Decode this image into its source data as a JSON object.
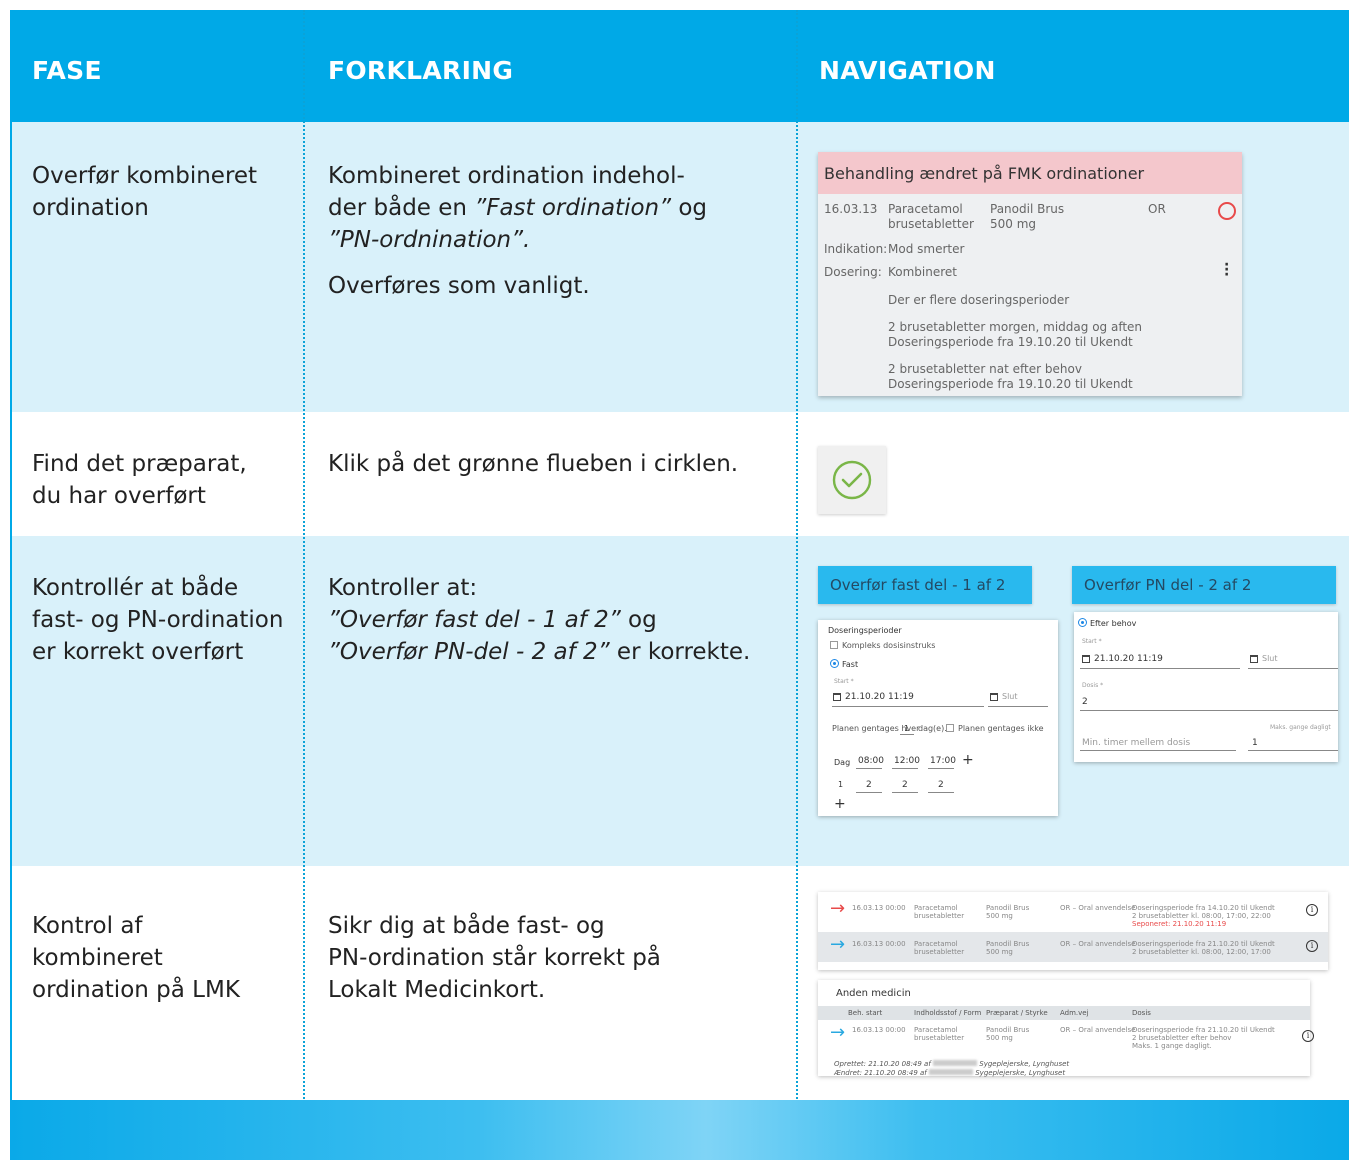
{
  "header": {
    "col1": "FASE",
    "col2": "FORKLARING",
    "col3": "NAVIGATION"
  },
  "rows": [
    {
      "fase": [
        "Overfør kombineret",
        "ordination"
      ],
      "forklaring_1": "Kombineret ordination indehol-",
      "forklaring_2a": "der både en ",
      "forklaring_2b": "”Fast ordination”",
      "forklaring_2c": " og",
      "forklaring_3": "”PN-ordnination”.",
      "forklaring_4": "Overføres som vanligt."
    },
    {
      "fase": [
        "Find det præparat,",
        "du har overført"
      ],
      "forklaring": "Klik på det grønne flueben i cirklen."
    },
    {
      "fase": [
        "Kontrollér at både",
        "fast- og PN-ordination",
        "er korrekt overført"
      ],
      "forklaring_1": "Kontroller at:",
      "forklaring_2a": "”Overfør fast del - 1 af 2”",
      "forklaring_2b": " og",
      "forklaring_3a": "”Overfør PN-del - 2 af 2”",
      "forklaring_3b": " er korrekte."
    },
    {
      "fase": [
        "Kontrol af",
        "kombineret",
        "ordination på LMK"
      ],
      "forklaring": [
        "Sikr dig at både fast- og",
        "PN-ordination står korrekt på",
        "Lokalt Medicinkort."
      ]
    }
  ],
  "fmk_card": {
    "title": "Behandling ændret på FMK ordinationer",
    "date": "16.03.13",
    "drug": [
      "Paracetamol",
      "brusetabletter"
    ],
    "product": [
      "Panodil Brus",
      "500 mg"
    ],
    "route": "OR",
    "indication_label": "Indikation:",
    "indication": "Mod smerter",
    "dosing_label": "Dosering:",
    "dosing": "Kombineret",
    "note": "Der er flere doseringsperioder",
    "period1": [
      "2 brusetabletter morgen, middag og aften",
      "Doseringsperiode fra 19.10.20 til Ukendt"
    ],
    "period2": [
      "2 brusetabletter nat efter behov",
      "Doseringsperiode fra 19.10.20 til Ukendt"
    ]
  },
  "fast_panel": {
    "title": "Overfør fast del - 1 af 2",
    "section": "Doseringsperioder",
    "complex": "Kompleks dosisinstruks",
    "fast": "Fast",
    "start_label": "Start *",
    "start": "21.10.20 11:19",
    "slut": "Slut",
    "repeat_prefix": "Planen gentages hver",
    "repeat_value": "1",
    "repeat_suffix": "dag(e).",
    "no_repeat": "Planen gentages ikke",
    "dag": "Dag",
    "times": [
      "08:00",
      "12:00",
      "17:00"
    ],
    "plus": "+",
    "day_num": "1",
    "doses": [
      "2",
      "2",
      "2"
    ]
  },
  "pn_panel": {
    "title": "Overfør PN del - 2 af 2",
    "efter_behov": "Efter behov",
    "start_label": "Start *",
    "start": "21.10.20 11:19",
    "slut": "Slut",
    "dosis_label": "Dosis *",
    "dosis": "2",
    "max_label": "Maks. gange dagligt",
    "min_label": "Min. timer mellem dosis",
    "max_value": "1"
  },
  "lmk": {
    "row1": {
      "date": "16.03.13 00:00",
      "drug": [
        "Paracetamol",
        "brusetabletter"
      ],
      "product": [
        "Panodil Brus",
        "500 mg"
      ],
      "route": "OR – Oral anvendelse",
      "dose": [
        "Doseringsperiode fra 14.10.20 til Ukendt",
        "2 brusetabletter kl. 08:00, 17:00, 22:00"
      ],
      "stopped": "Seponeret: 21.10.20 11:19"
    },
    "row2": {
      "date": "16.03.13 00:00",
      "drug": [
        "Paracetamol",
        "brusetabletter"
      ],
      "product": [
        "Panodil Brus",
        "500 mg"
      ],
      "route": "OR – Oral anvendelse",
      "dose": [
        "Doseringsperiode fra 21.10.20 til Ukendt",
        "2 brusetabletter kl. 08:00, 12:00, 17:00"
      ]
    },
    "anden_title": "Anden medicin",
    "columns": [
      "Beh. start",
      "Indholdsstof / Form",
      "Præparat / Styrke",
      "Adm.vej",
      "Dosis"
    ],
    "row3": {
      "date": "16.03.13 00:00",
      "drug": [
        "Paracetamol",
        "brusetabletter"
      ],
      "product": [
        "Panodil Brus",
        "500 mg"
      ],
      "route": "OR – Oral anvendelse",
      "dose": [
        "Doseringsperiode fra 21.10.20 til Ukendt",
        "2 brusetabletter efter behov",
        "Maks. 1 gange dagligt."
      ]
    },
    "created": "Oprettet: 21.10.20 08:49 af",
    "created_suffix": "Sygeplejerske, Lynghuset",
    "changed": "Ændret: 21.10.20 08:49 af",
    "changed_suffix": "Sygeplejerske, Lynghuset",
    "info": "i"
  },
  "colors": {
    "header": "#00a9e7",
    "row_tint": "#d9f1fa",
    "check_green": "#7ab648",
    "arrow_red": "#e84a4a",
    "arrow_blue": "#29a8e0"
  }
}
